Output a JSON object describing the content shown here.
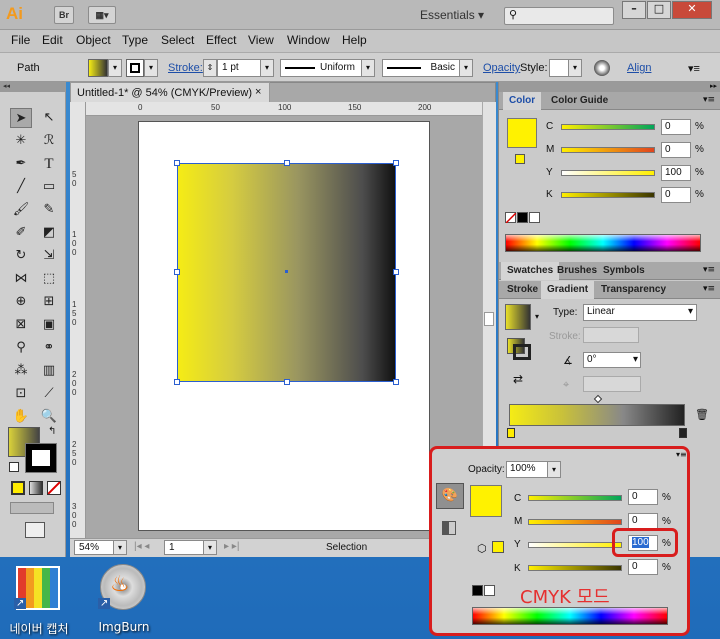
{
  "app": {
    "logo": "Ai",
    "bridge_label": "Br",
    "workspace": "Essentials"
  },
  "menu": [
    "File",
    "Edit",
    "Object",
    "Type",
    "Select",
    "Effect",
    "View",
    "Window",
    "Help"
  ],
  "control": {
    "selection_label": "Path",
    "stroke_label": "Stroke:",
    "stroke_value": "1 pt",
    "profile_value": "Uniform",
    "brush_value": "Basic",
    "opacity_label": "Opacity",
    "style_label": "Style:",
    "align_label": "Align"
  },
  "document": {
    "tab_title": "Untitled-1* @ 54% (CMYK/Preview)",
    "close": "×",
    "ruler_h": [
      "0",
      "50",
      "100",
      "150",
      "200"
    ],
    "ruler_v": [
      "5 0",
      "1 0 0",
      "1 5 0",
      "2 0 0",
      "2 5 0",
      "3 0 0"
    ],
    "zoom": "54%",
    "page": "1",
    "status": "Selection"
  },
  "color_panel": {
    "tabs": [
      "Color",
      "Color Guide"
    ],
    "channels": [
      {
        "label": "C",
        "value": "0"
      },
      {
        "label": "M",
        "value": "0"
      },
      {
        "label": "Y",
        "value": "100"
      },
      {
        "label": "K",
        "value": "0"
      }
    ],
    "pct": "%"
  },
  "swatch_tabs": [
    "Swatches",
    "Brushes",
    "Symbols"
  ],
  "gradient_panel": {
    "tabs": [
      "Stroke",
      "Gradient",
      "Transparency"
    ],
    "type_label": "Type:",
    "type_value": "Linear",
    "stroke_label": "Stroke:",
    "angle_value": "0°"
  },
  "callout": {
    "opacity_label": "Opacity:",
    "opacity_value": "100%",
    "channels": [
      {
        "label": "C",
        "value": "0"
      },
      {
        "label": "M",
        "value": "0"
      },
      {
        "label": "Y",
        "value": "100"
      },
      {
        "label": "K",
        "value": "0"
      }
    ],
    "pct": "%",
    "annotation": "CMYK 모드"
  },
  "desktop": [
    {
      "label": "네이버 캡처"
    },
    {
      "label": "ImgBurn"
    }
  ],
  "colors": {
    "accent_red": "#d81d1d",
    "yellow": "#fff200",
    "link_blue": "#1d4ea8"
  }
}
